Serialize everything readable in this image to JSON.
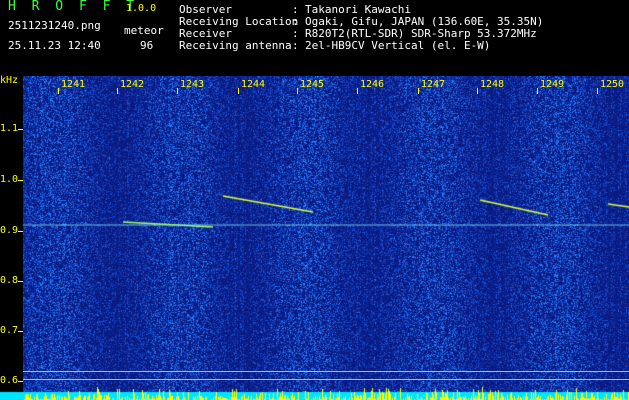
{
  "header": {
    "app_title": "H R O F F T",
    "version": "1.0.0",
    "filename": "2511231240.png",
    "datetime": "25.11.23 12:40",
    "mode_label": "meteor",
    "count": "96"
  },
  "station_info": [
    {
      "key": "Observer",
      "sep": ":",
      "value": "Takanori Kawachi"
    },
    {
      "key": "Receiving Location",
      "sep": ":",
      "value": "Ogaki, Gifu, JAPAN (136.60E, 35.35N)"
    },
    {
      "key": "Receiver",
      "sep": ":",
      "value": "R820T2(RTL-SDR) SDR-Sharp 53.372MHz"
    },
    {
      "key": "Receiving antenna",
      "sep": ":",
      "value": "2el-HB9CV Vertical (el. E-W)"
    }
  ],
  "spectrogram": {
    "y_unit": "kHz",
    "y_ticks": [
      "1.1",
      "1.0",
      "0.9",
      "0.8",
      "0.7",
      "0.6"
    ],
    "x_ticks": [
      "1241",
      "1242",
      "1243",
      "1244",
      "1245",
      "1246",
      "1247",
      "1248",
      "1249",
      "1250"
    ],
    "background_color": "#0a1a80",
    "noise_color": "#2e8cff",
    "signal_color": "#d9ff3c",
    "power_band_color": "#00e5ff",
    "power_peak_color": "#ffff00"
  }
}
